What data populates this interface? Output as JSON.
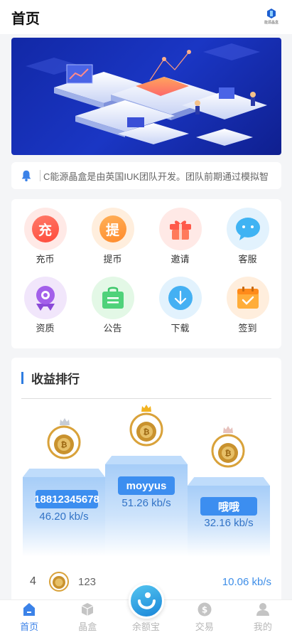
{
  "header": {
    "title": "首页",
    "logo_text": "能源晶盒"
  },
  "notice": {
    "text": "C能源晶盒是由英国IUK团队开发。团队前期通过模拟智"
  },
  "grid": [
    {
      "label": "充币",
      "glyph": "充",
      "icon": "recharge-icon"
    },
    {
      "label": "提币",
      "glyph": "提",
      "icon": "withdraw-icon"
    },
    {
      "label": "邀请",
      "glyph": "",
      "icon": "gift-icon"
    },
    {
      "label": "客服",
      "glyph": "",
      "icon": "chat-icon"
    },
    {
      "label": "资质",
      "glyph": "",
      "icon": "medal-icon"
    },
    {
      "label": "公告",
      "glyph": "",
      "icon": "bag-icon"
    },
    {
      "label": "下载",
      "glyph": "",
      "icon": "download-icon"
    },
    {
      "label": "签到",
      "glyph": "",
      "icon": "calendar-check-icon"
    }
  ],
  "ranking": {
    "title": "收益排行",
    "first": {
      "name": "moyyus",
      "speed": "51.26 kb/s"
    },
    "second": {
      "name": "18812345678",
      "speed": "46.20 kb/s"
    },
    "third": {
      "name": "哦哦",
      "speed": "32.16 kb/s"
    },
    "rows": [
      {
        "rank": "4",
        "name": "123",
        "speed": "10.06 kb/s"
      }
    ]
  },
  "tabbar": [
    {
      "label": "首页",
      "icon": "home-icon",
      "active": true
    },
    {
      "label": "晶盒",
      "icon": "cube-icon",
      "active": false
    },
    {
      "label": "余额宝",
      "icon": "wallet-icon",
      "active": false
    },
    {
      "label": "交易",
      "icon": "dollar-icon",
      "active": false
    },
    {
      "label": "我的",
      "icon": "user-icon",
      "active": false
    }
  ],
  "colors": {
    "accent": "#3b82e8",
    "banner": "#1a36c4"
  }
}
